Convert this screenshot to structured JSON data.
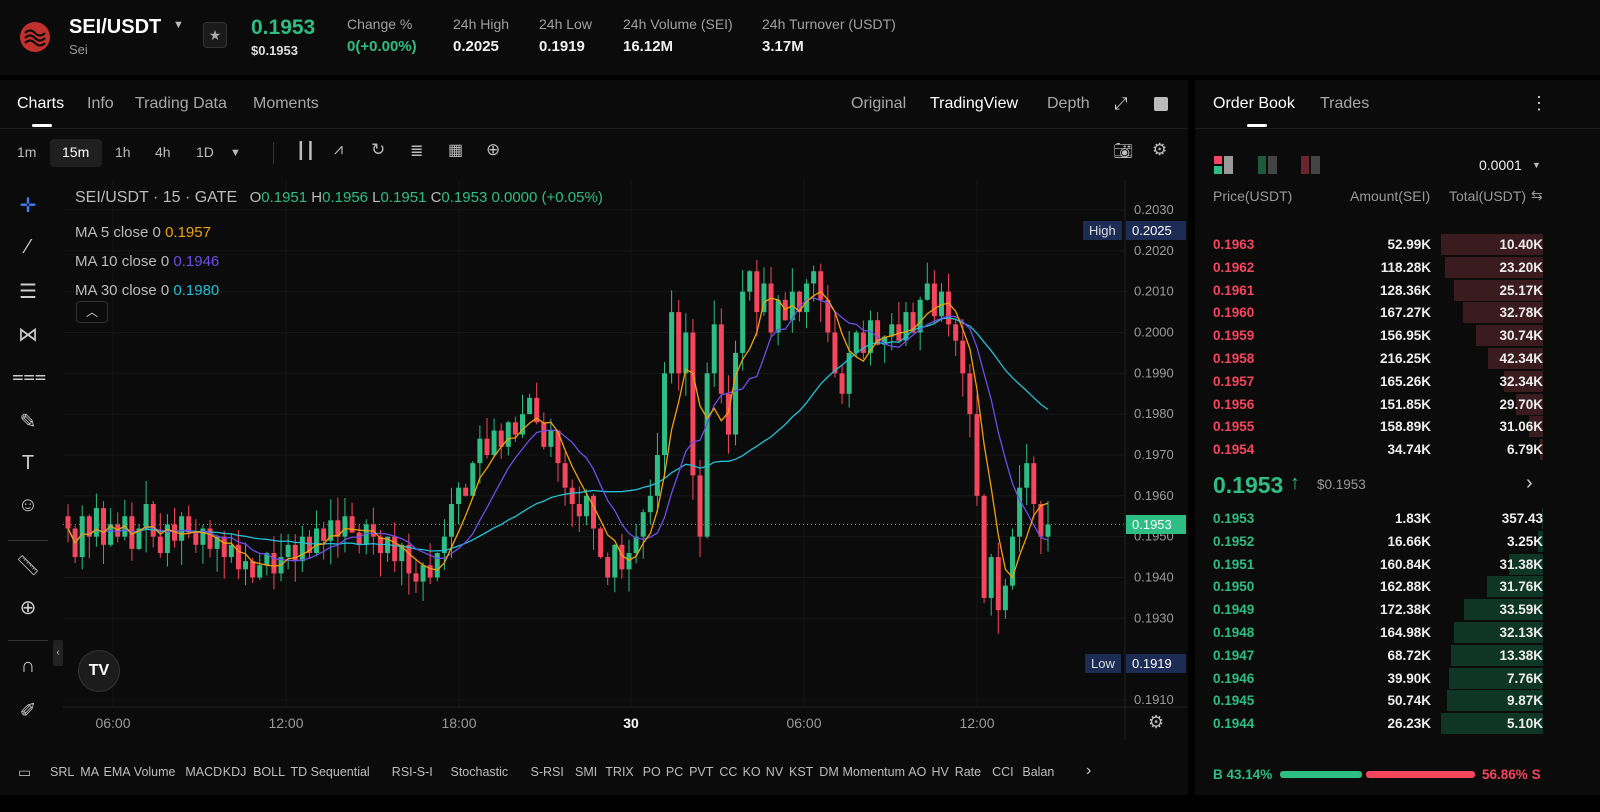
{
  "header": {
    "pair": "SEI/USDT",
    "name": "Sei",
    "last": "0.1953",
    "last_usd": "$0.1953",
    "stats": [
      {
        "label": "Change %",
        "value": "0(+0.00%)",
        "color": "green"
      },
      {
        "label": "24h High",
        "value": "0.2025"
      },
      {
        "label": "24h Low",
        "value": "0.1919"
      },
      {
        "label": "24h Volume (SEI)",
        "value": "16.12M"
      },
      {
        "label": "24h Turnover (USDT)",
        "value": "3.17M"
      }
    ]
  },
  "chart_tabs": [
    "Charts",
    "Info",
    "Trading Data",
    "Moments"
  ],
  "view_tabs": [
    "Original",
    "TradingView",
    "Depth"
  ],
  "timeframes": [
    "1m",
    "15m",
    "1h",
    "4h",
    "1D"
  ],
  "legend": {
    "symbol": "SEI/USDT · 15 · GATE",
    "o": "0.1951",
    "h": "0.1956",
    "l": "0.1951",
    "c": "0.1953",
    "chg": "0.0000 (+0.05%)",
    "ma": [
      {
        "label": "MA 5 close 0",
        "value": "0.1957",
        "color": "#f0a30a"
      },
      {
        "label": "MA 10 close 0",
        "value": "0.1946",
        "color": "#6c4ee8"
      },
      {
        "label": "MA 30 close 0",
        "value": "0.1980",
        "color": "#22c0d6"
      }
    ]
  },
  "markers": {
    "high_label": "High",
    "high": "0.2025",
    "low_label": "Low",
    "low": "0.1919",
    "current": "0.1953"
  },
  "colors": {
    "up": "#2ebd85",
    "down": "#f6465d"
  },
  "chart_data": {
    "type": "candlestick",
    "price_ticks": [
      "0.2030",
      "0.2020",
      "0.2010",
      "0.2000",
      "0.1990",
      "0.1980",
      "0.1970",
      "0.1960",
      "0.1950",
      "0.1940",
      "0.1930",
      "0.1910"
    ],
    "ylim": [
      0.1905,
      0.2034
    ],
    "time_ticks": [
      "06:00",
      "12:00",
      "18:00",
      "30",
      "06:00",
      "12:00"
    ],
    "interval_minutes": 15,
    "closes": [
      0.1952,
      0.1945,
      0.1955,
      0.195,
      0.1957,
      0.1948,
      0.1953,
      0.195,
      0.1955,
      0.1947,
      0.1952,
      0.1958,
      0.195,
      0.1946,
      0.1953,
      0.1949,
      0.1955,
      0.1951,
      0.1948,
      0.1952,
      0.1947,
      0.195,
      0.1945,
      0.1948,
      0.1942,
      0.1944,
      0.194,
      0.1943,
      0.1946,
      0.1941,
      0.1945,
      0.1948,
      0.1944,
      0.195,
      0.1946,
      0.1952,
      0.1949,
      0.1954,
      0.195,
      0.1955,
      0.1951,
      0.1948,
      0.1953,
      0.195,
      0.1946,
      0.195,
      0.1944,
      0.1948,
      0.1941,
      0.1939,
      0.1943,
      0.194,
      0.1946,
      0.195,
      0.1958,
      0.1962,
      0.196,
      0.1968,
      0.1974,
      0.197,
      0.1976,
      0.1972,
      0.1978,
      0.1975,
      0.198,
      0.1984,
      0.1978,
      0.1972,
      0.1976,
      0.1968,
      0.1962,
      0.1958,
      0.1955,
      0.196,
      0.1952,
      0.1945,
      0.194,
      0.1948,
      0.1942,
      0.1946,
      0.195,
      0.1956,
      0.196,
      0.197,
      0.199,
      0.2005,
      0.199,
      0.2,
      0.1965,
      0.195,
      0.199,
      0.2002,
      0.1985,
      0.1975,
      0.1995,
      0.201,
      0.2015,
      0.2005,
      0.2012,
      0.2,
      0.2008,
      0.2003,
      0.201,
      0.2005,
      0.2012,
      0.2015,
      0.2008,
      0.2,
      0.199,
      0.1985,
      0.1995,
      0.2,
      0.1995,
      0.2003,
      0.1997,
      0.1999,
      0.2002,
      0.1998,
      0.2005,
      0.2,
      0.2008,
      0.2012,
      0.2004,
      0.201,
      0.2002,
      0.1998,
      0.199,
      0.198,
      0.196,
      0.1935,
      0.1945,
      0.1932,
      0.1938,
      0.195,
      0.1962,
      0.1968,
      0.1958,
      0.195,
      0.1953
    ]
  },
  "indicators": [
    "SRL",
    "MA",
    "EMA",
    "Volume",
    "MACD",
    "KDJ",
    "BOLL",
    "TD Sequential",
    "RSI-S-I",
    "Stochastic",
    "S-RSI",
    "SMI",
    "TRIX",
    "PO",
    "PC",
    "PVT",
    "CC",
    "KO",
    "NV",
    "KST",
    "DM",
    "Momentum",
    "AO",
    "HV",
    "Rate",
    "CCI",
    "Balan"
  ],
  "orderbook": {
    "tabs": [
      "Order Book",
      "Trades"
    ],
    "precision": "0.0001",
    "headers": [
      "Price(USDT)",
      "Amount(SEI)",
      "Total(USDT)"
    ],
    "asks": [
      [
        "0.1963",
        "52.99K",
        "10.40K",
        1.0
      ],
      [
        "0.1962",
        "118.28K",
        "23.20K",
        0.96
      ],
      [
        "0.1961",
        "128.36K",
        "25.17K",
        0.87
      ],
      [
        "0.1960",
        "167.27K",
        "32.78K",
        0.78
      ],
      [
        "0.1959",
        "156.95K",
        "30.74K",
        0.66
      ],
      [
        "0.1958",
        "216.25K",
        "42.34K",
        0.54
      ],
      [
        "0.1957",
        "165.26K",
        "32.34K",
        0.38
      ],
      [
        "0.1956",
        "151.85K",
        "29.70K",
        0.26
      ],
      [
        "0.1955",
        "158.89K",
        "31.06K",
        0.14
      ],
      [
        "0.1954",
        "34.74K",
        "6.79K",
        0.03
      ]
    ],
    "mid": "0.1953",
    "mid_usd": "$0.1953",
    "bids": [
      [
        "0.1953",
        "1.83K",
        "357.43",
        0.01
      ],
      [
        "0.1952",
        "16.66K",
        "3.25K",
        0.05
      ],
      [
        "0.1951",
        "160.84K",
        "31.38K",
        0.33
      ],
      [
        "0.1950",
        "162.88K",
        "31.76K",
        0.55
      ],
      [
        "0.1949",
        "172.38K",
        "33.59K",
        0.77
      ],
      [
        "0.1948",
        "164.98K",
        "32.13K",
        0.87
      ],
      [
        "0.1947",
        "68.72K",
        "13.38K",
        0.9
      ],
      [
        "0.1946",
        "39.90K",
        "7.76K",
        0.92
      ],
      [
        "0.1945",
        "50.74K",
        "9.87K",
        0.94
      ],
      [
        "0.1944",
        "26.23K",
        "5.10K",
        1.0
      ]
    ],
    "buy_pct": "43.14%",
    "sell_pct": "56.86%",
    "buy_label": "B",
    "sell_label": "S",
    "buy_fraction": 0.4314
  }
}
